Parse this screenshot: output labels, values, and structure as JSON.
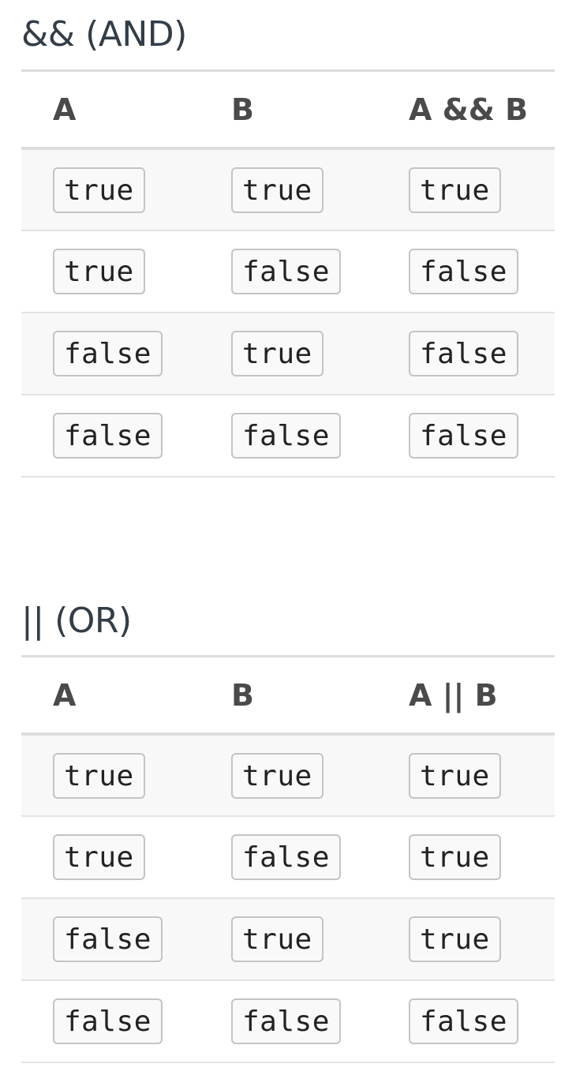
{
  "sections": [
    {
      "title": "&& (AND)",
      "headers": [
        "A",
        "B",
        "A && B"
      ],
      "rows": [
        [
          "true",
          "true",
          "true"
        ],
        [
          "true",
          "false",
          "false"
        ],
        [
          "false",
          "true",
          "false"
        ],
        [
          "false",
          "false",
          "false"
        ]
      ]
    },
    {
      "title": "|| (OR)",
      "headers": [
        "A",
        "B",
        "A || B"
      ],
      "rows": [
        [
          "true",
          "true",
          "true"
        ],
        [
          "true",
          "false",
          "true"
        ],
        [
          "false",
          "true",
          "true"
        ],
        [
          "false",
          "false",
          "false"
        ]
      ]
    }
  ]
}
